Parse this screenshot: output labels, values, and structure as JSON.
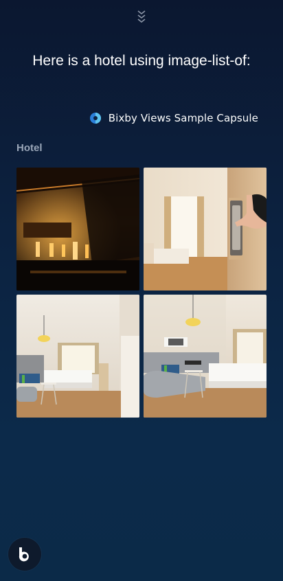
{
  "header": {
    "collapse_icon": "double-chevron-down-icon"
  },
  "conversation": {
    "response_text": "Here is a hotel using image-list-of:",
    "capsule_icon": "bixby-capsule-icon",
    "capsule_name": "Bixby Views Sample Capsule"
  },
  "section": {
    "title": "Hotel",
    "images": [
      {
        "name": "hotel-lobby-bar-image"
      },
      {
        "name": "hotel-door-keycard-image"
      },
      {
        "name": "hotel-room-image-1"
      },
      {
        "name": "hotel-room-image-2"
      }
    ]
  },
  "footer": {
    "bixby_button_icon": "bixby-logo-icon"
  }
}
